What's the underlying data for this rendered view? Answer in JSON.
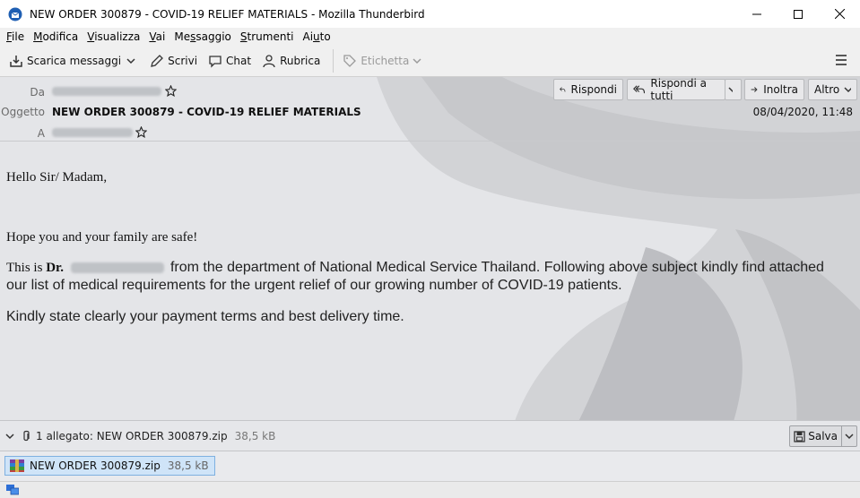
{
  "window": {
    "title": "NEW ORDER 300879 - COVID-19 RELIEF MATERIALS - Mozilla Thunderbird"
  },
  "menu": {
    "items": [
      {
        "pre": "",
        "ul": "F",
        "post": "ile"
      },
      {
        "pre": "",
        "ul": "M",
        "post": "odifica"
      },
      {
        "pre": "",
        "ul": "V",
        "post": "isualizza"
      },
      {
        "pre": "",
        "ul": "V",
        "post": "ai"
      },
      {
        "pre": "Me",
        "ul": "s",
        "post": "saggio"
      },
      {
        "pre": "",
        "ul": "S",
        "post": "trumenti"
      },
      {
        "pre": "Ai",
        "ul": "u",
        "post": "to"
      }
    ]
  },
  "toolbar": {
    "get_messages": "Scarica messaggi",
    "write": "Scrivi",
    "chat": "Chat",
    "address_book": "Rubrica",
    "tag": "Etichetta"
  },
  "header": {
    "from_label": "Da",
    "subject_label": "Oggetto",
    "to_label": "A",
    "subject": "NEW ORDER 300879 - COVID-19 RELIEF MATERIALS",
    "date": "08/04/2020, 11:48",
    "reply": "Rispondi",
    "reply_all": "Rispondi a tutti",
    "forward": "Inoltra",
    "more": "Altro"
  },
  "body": {
    "greeting": "Hello Sir/ Madam,",
    "line1": "Hope you and your family are safe!",
    "para_prefix": "This is ",
    "dr": "Dr.",
    "para_rest": " from the department of National Medical Service Thailand. Following above subject kindly find attached our list of medical requirements for the urgent relief of our growing number of COVID-19 patients.",
    "line3": "Kindly state clearly your payment terms and best delivery time."
  },
  "attachment_bar": {
    "summary": "1 allegato: NEW ORDER 300879.zip",
    "size": "38,5 kB",
    "save": "Salva"
  },
  "attachment": {
    "name": "NEW ORDER 300879.zip",
    "size": "38,5 kB"
  }
}
